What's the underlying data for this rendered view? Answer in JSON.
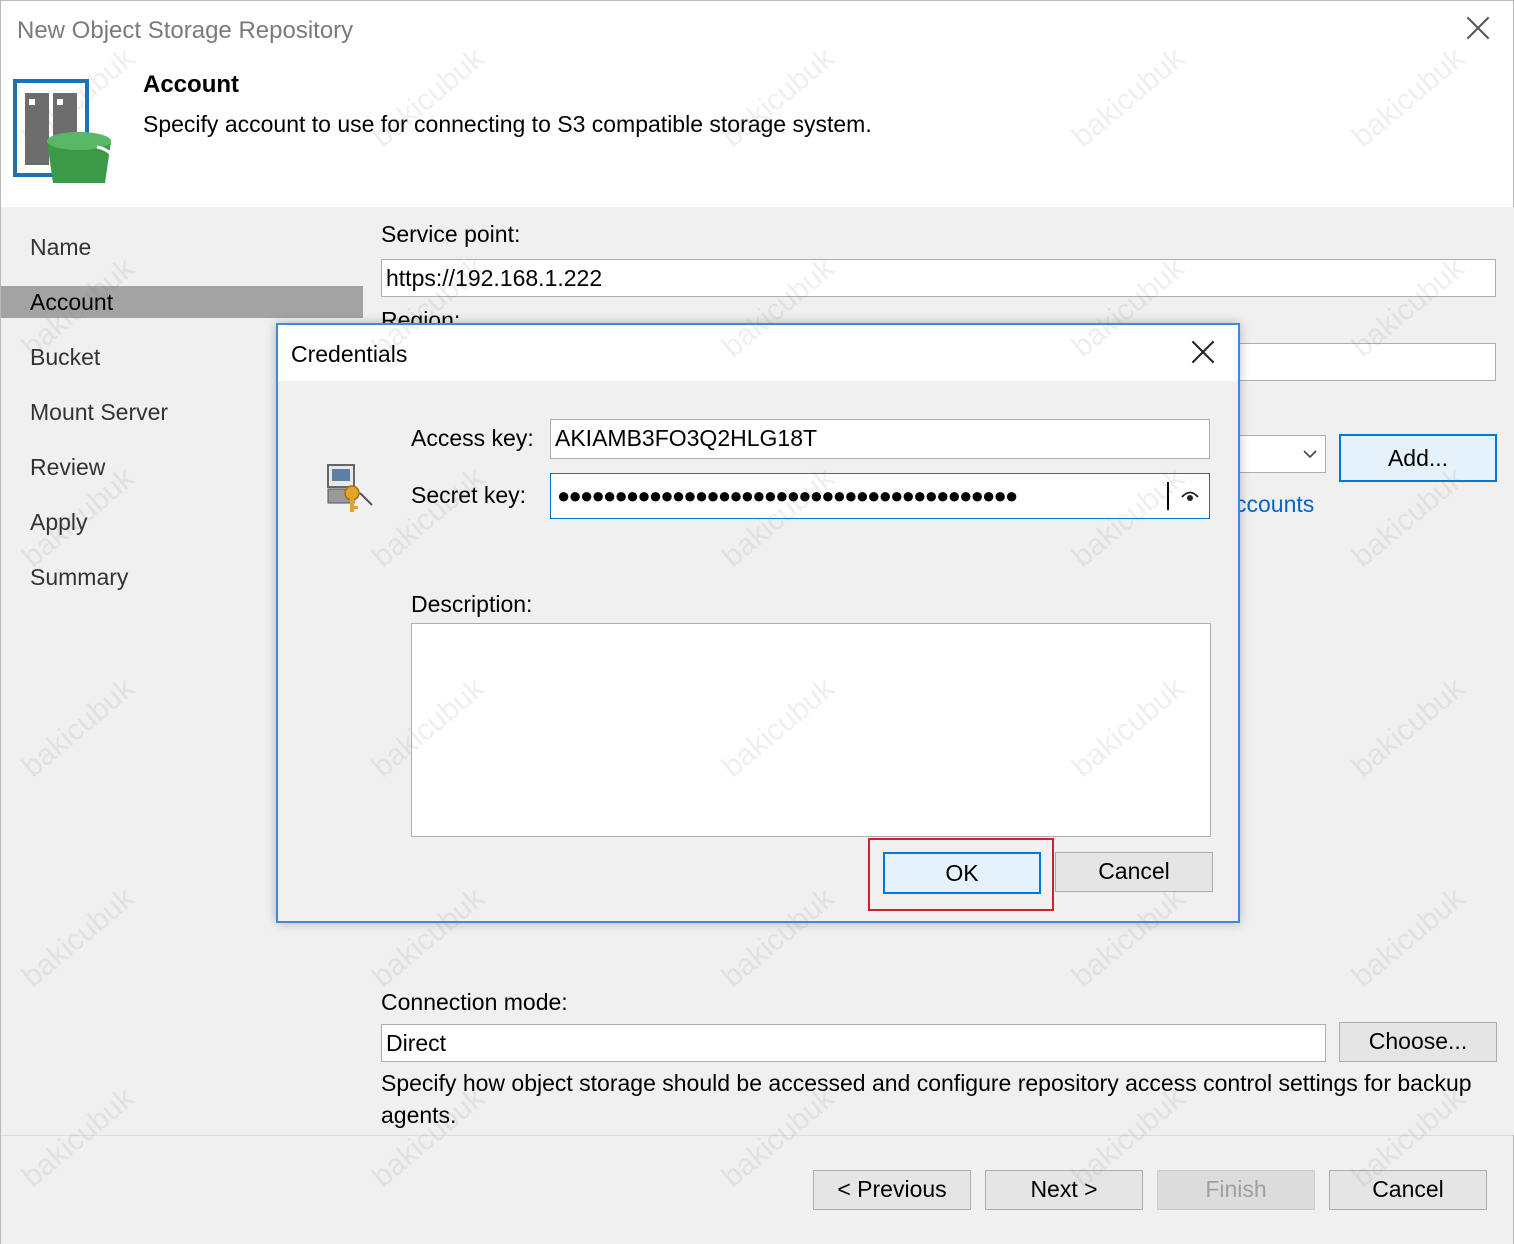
{
  "window": {
    "title": "New Object Storage Repository"
  },
  "header": {
    "title": "Account",
    "description": "Specify account to use for connecting to S3 compatible storage system.",
    "icon": "storage-bucket-icon"
  },
  "sidebar": {
    "items": [
      {
        "label": "Name"
      },
      {
        "label": "Account"
      },
      {
        "label": "Bucket"
      },
      {
        "label": "Mount Server"
      },
      {
        "label": "Review"
      },
      {
        "label": "Apply"
      },
      {
        "label": "Summary"
      }
    ],
    "active": "Account"
  },
  "main": {
    "service_point_label": "Service point:",
    "service_point_value": "https://192.168.1.222",
    "region_label": "Region:",
    "add_button": "Add...",
    "accounts_link": "ccounts",
    "connection_mode_label": "Connection mode:",
    "connection_mode_value": "Direct",
    "choose_button": "Choose...",
    "connection_mode_help": "Specify how object storage should be accessed and configure repository access control settings for backup agents."
  },
  "footer": {
    "previous": "< Previous",
    "next": "Next >",
    "finish": "Finish",
    "cancel": "Cancel"
  },
  "dialog": {
    "title": "Credentials",
    "access_key_label": "Access key:",
    "access_key_value": "AKIAMB3FO3Q2HLG18T",
    "secret_key_label": "Secret key:",
    "secret_key_mask": "●●●●●●●●●●●●●●●●●●●●●●●●●●●●●●●●●●●●●●●●",
    "description_label": "Description:",
    "description_value": "",
    "ok_button": "OK",
    "cancel_button": "Cancel"
  },
  "watermark": "bakicubuk",
  "colors": {
    "accent": "#0078d7",
    "highlight": "#d0202b",
    "link": "#0066cc"
  }
}
